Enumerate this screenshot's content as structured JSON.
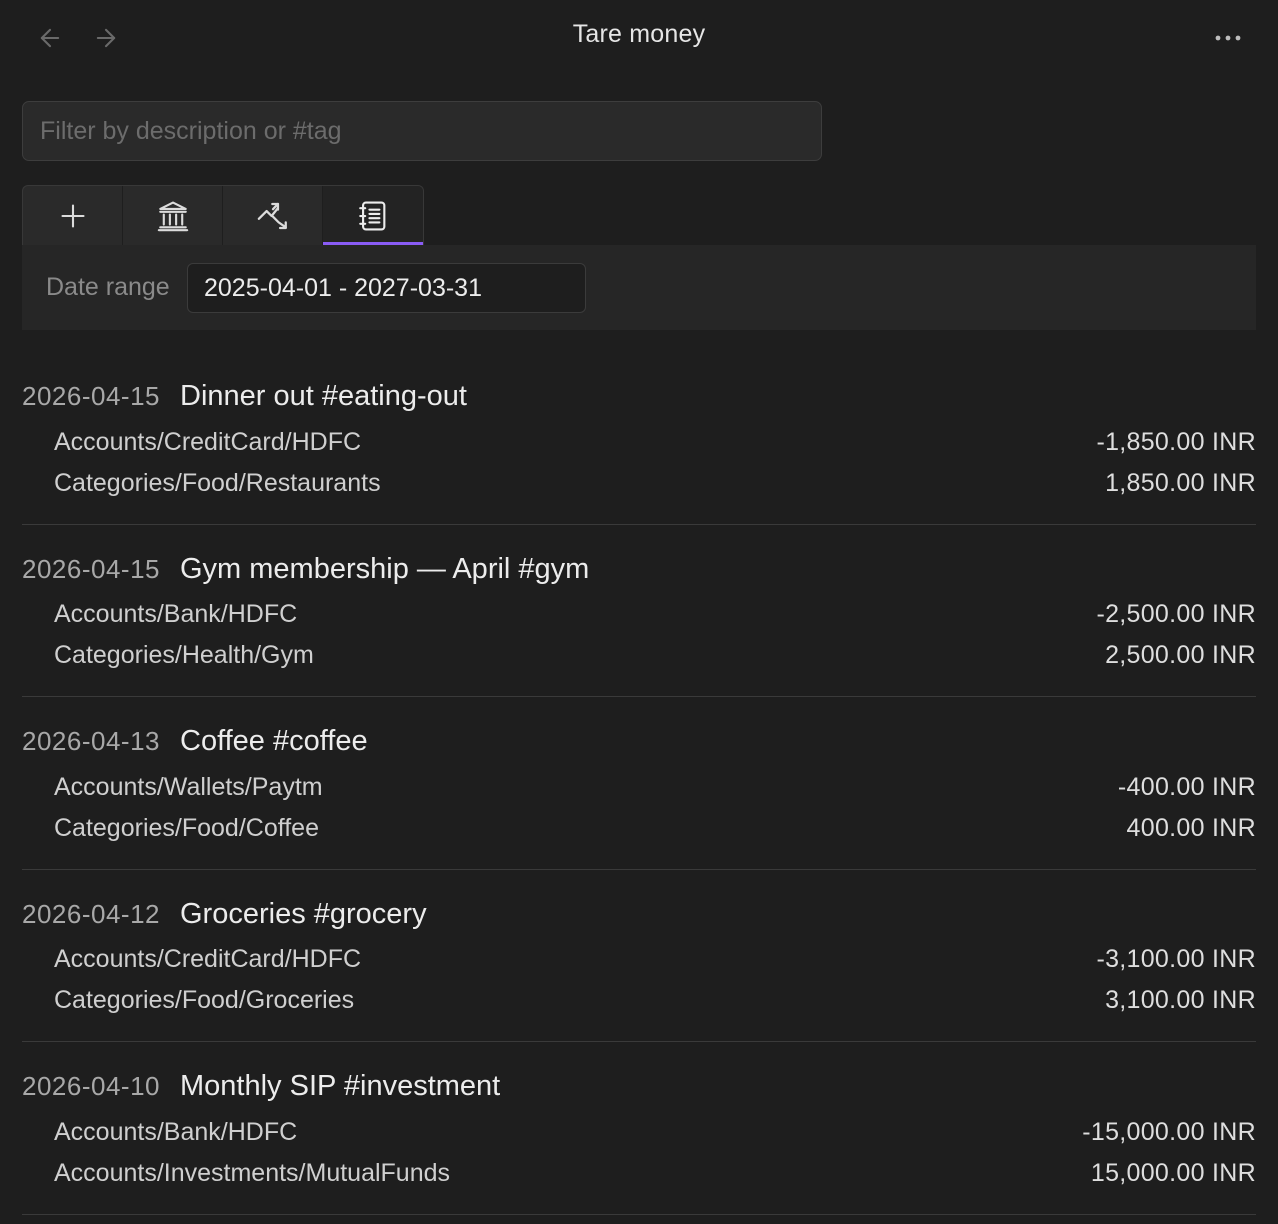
{
  "header": {
    "title": "Tare money"
  },
  "filter": {
    "placeholder": "Filter by description or #tag",
    "value": ""
  },
  "tabs": [
    {
      "icon": "plus-icon",
      "active": false
    },
    {
      "icon": "bank-icon",
      "active": false
    },
    {
      "icon": "trend-chart-icon",
      "active": false
    },
    {
      "icon": "ledger-list-icon",
      "active": true
    }
  ],
  "accent_color": "#8a5cf5",
  "toolbar": {
    "date_range_label": "Date range",
    "date_range_value": "2025-04-01 - 2027-03-31"
  },
  "transactions": [
    {
      "date": "2026-04-15",
      "description": "Dinner out #eating-out",
      "postings": [
        {
          "account": "Accounts/CreditCard/HDFC",
          "amount": "-1,850.00 INR"
        },
        {
          "account": "Categories/Food/Restaurants",
          "amount": "1,850.00 INR"
        }
      ]
    },
    {
      "date": "2026-04-15",
      "description": "Gym membership — April #gym",
      "postings": [
        {
          "account": "Accounts/Bank/HDFC",
          "amount": "-2,500.00 INR"
        },
        {
          "account": "Categories/Health/Gym",
          "amount": "2,500.00 INR"
        }
      ]
    },
    {
      "date": "2026-04-13",
      "description": "Coffee #coffee",
      "postings": [
        {
          "account": "Accounts/Wallets/Paytm",
          "amount": "-400.00 INR"
        },
        {
          "account": "Categories/Food/Coffee",
          "amount": "400.00 INR"
        }
      ]
    },
    {
      "date": "2026-04-12",
      "description": "Groceries #grocery",
      "postings": [
        {
          "account": "Accounts/CreditCard/HDFC",
          "amount": "-3,100.00 INR"
        },
        {
          "account": "Categories/Food/Groceries",
          "amount": "3,100.00 INR"
        }
      ]
    },
    {
      "date": "2026-04-10",
      "description": "Monthly SIP #investment",
      "postings": [
        {
          "account": "Accounts/Bank/HDFC",
          "amount": "-15,000.00 INR"
        },
        {
          "account": "Accounts/Investments/MutualFunds",
          "amount": "15,000.00 INR"
        }
      ]
    }
  ]
}
